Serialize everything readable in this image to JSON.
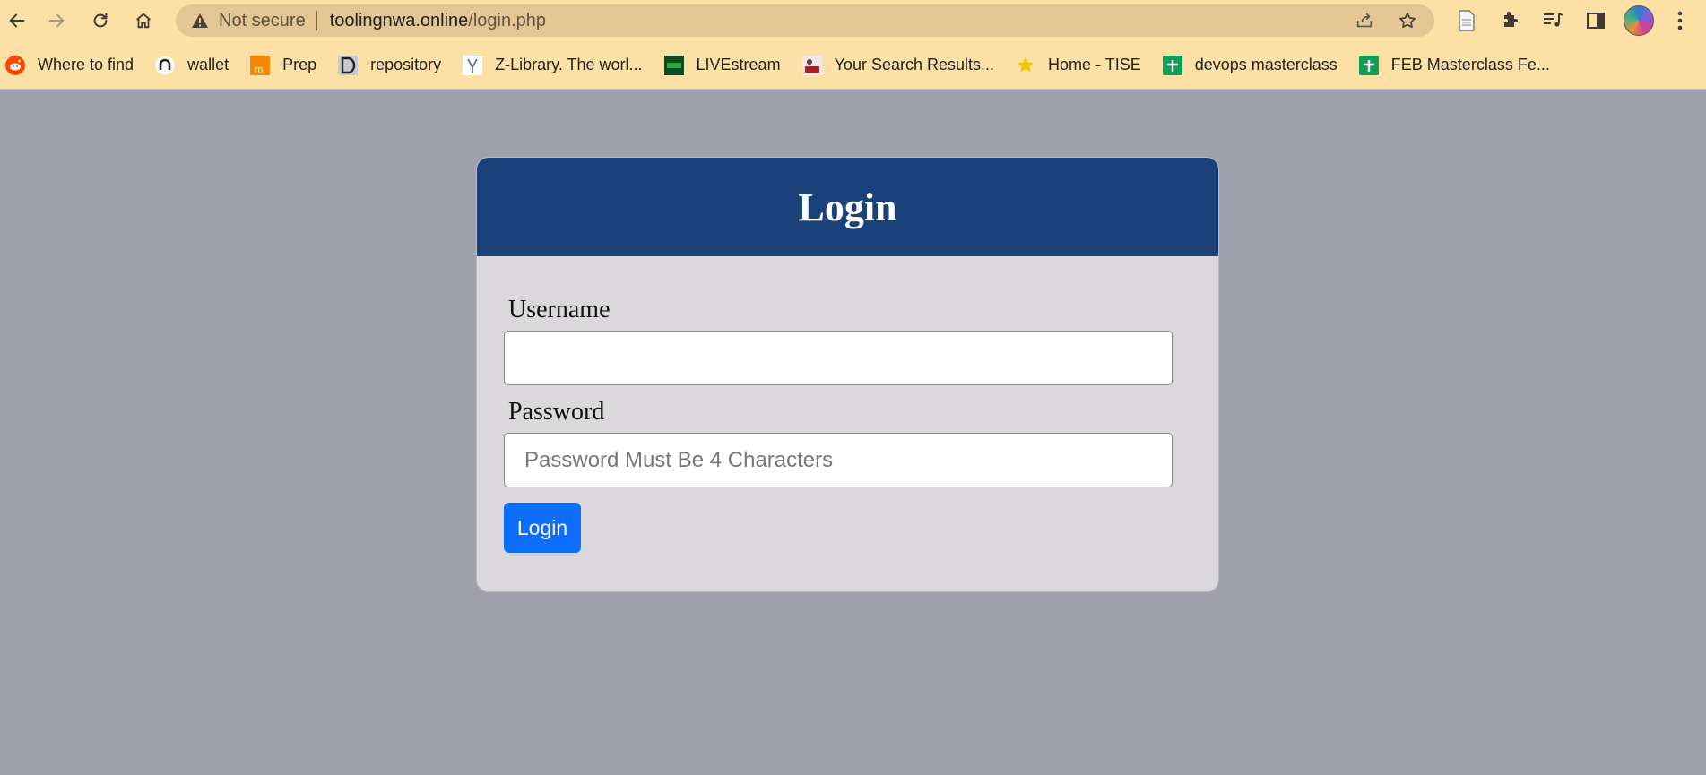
{
  "browser": {
    "security_label": "Not secure",
    "url_host": "toolingnwa.online",
    "url_path": "/login.php",
    "colors": {
      "chrome_bg": "#fde0a6",
      "omnibox_bg": "#e4c693"
    }
  },
  "bookmarks": [
    {
      "label": "Where to find",
      "icon": "reddit-icon"
    },
    {
      "label": "wallet",
      "icon": "wallet-icon"
    },
    {
      "label": "Prep",
      "icon": "prep-icon"
    },
    {
      "label": "repository",
      "icon": "repository-icon"
    },
    {
      "label": "Z-Library. The worl...",
      "icon": "zlibrary-icon"
    },
    {
      "label": "LIVEstream",
      "icon": "livestream-icon"
    },
    {
      "label": "Your Search Results...",
      "icon": "search-results-icon"
    },
    {
      "label": "Home - TISE",
      "icon": "star-icon"
    },
    {
      "label": "devops masterclass",
      "icon": "sheets-icon"
    },
    {
      "label": "FEB Masterclass Fe...",
      "icon": "sheets-icon"
    }
  ],
  "login": {
    "title": "Login",
    "username_label": "Username",
    "username_value": "",
    "password_label": "Password",
    "password_placeholder": "Password Must Be 4 Characters",
    "submit_label": "Login",
    "colors": {
      "page_bg": "#a0a0ac",
      "header_bg": "#1b417b",
      "card_bg": "#dad8da",
      "button_bg": "#0d6efd"
    }
  }
}
